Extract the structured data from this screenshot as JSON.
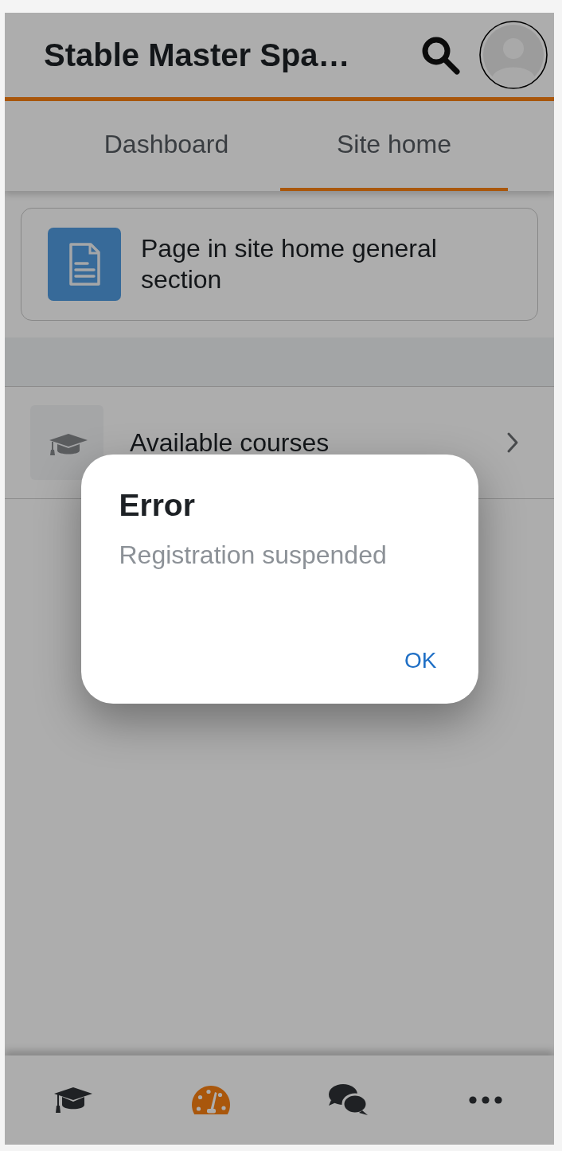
{
  "header": {
    "title": "Stable Master Spa…"
  },
  "tabs": [
    {
      "label": "Dashboard",
      "selected": false
    },
    {
      "label": "Site home",
      "selected": true
    }
  ],
  "page_card": {
    "title": "Page in site home general section"
  },
  "list_items": [
    {
      "label": "Available courses"
    }
  ],
  "bottom_tabs": [
    {
      "kind": "courses",
      "selected": false
    },
    {
      "kind": "dashboard",
      "selected": true
    },
    {
      "kind": "messages",
      "selected": false
    },
    {
      "kind": "more",
      "selected": false
    }
  ],
  "dialog": {
    "title": "Error",
    "message": "Registration suspended",
    "button": "OK"
  }
}
